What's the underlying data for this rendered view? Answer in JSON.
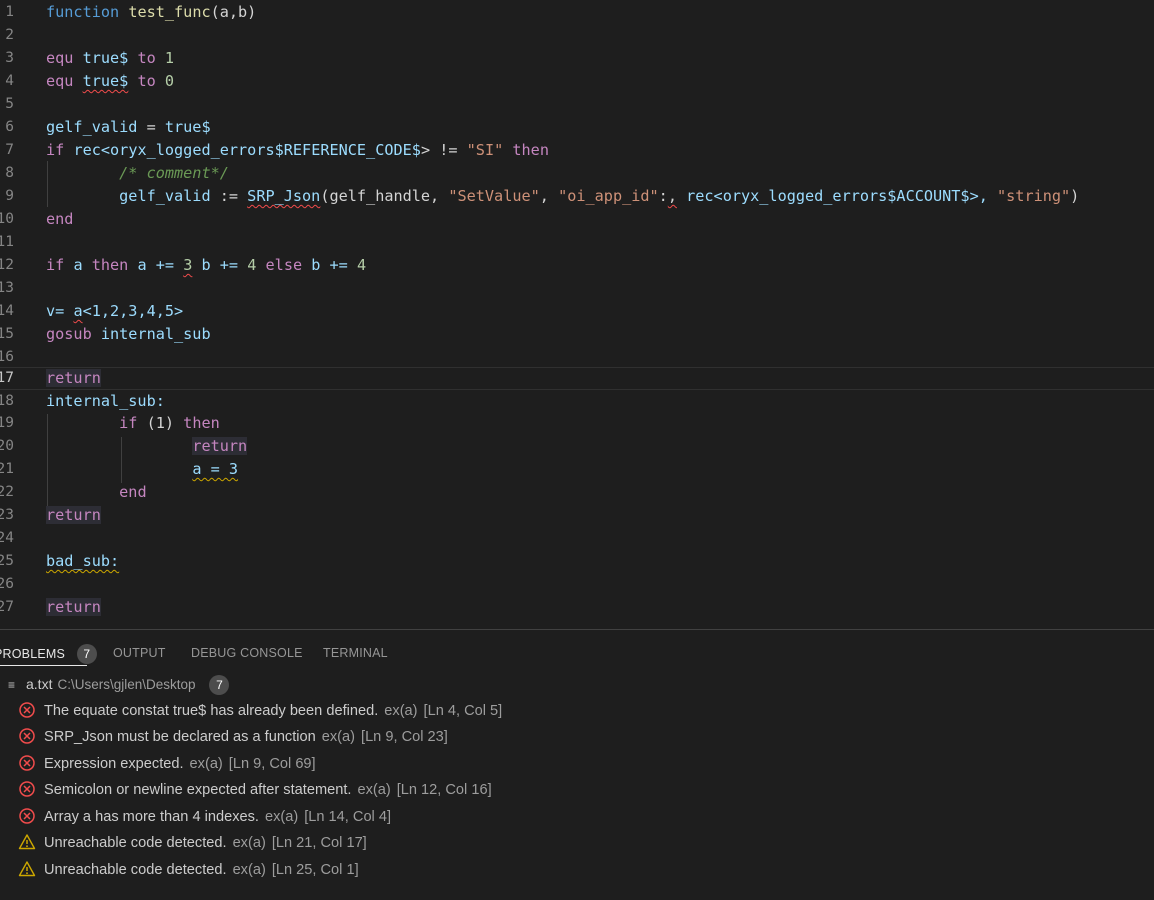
{
  "editor": {
    "line_numbers": [
      "1",
      "2",
      "3",
      "4",
      "5",
      "6",
      "7",
      "8",
      "9",
      "10",
      "11",
      "12",
      "13",
      "14",
      "15",
      "16",
      "17",
      "18",
      "19",
      "20",
      "21",
      "22",
      "23",
      "24",
      "25",
      "26",
      "27"
    ],
    "tokens": {
      "l1_kw": "function",
      "l1_fn": "test_func",
      "l1_rest": "(a,b)",
      "l3_kw": "equ",
      "l3_var": "true$",
      "l3_to": "to",
      "l3_num": "1",
      "l4_kw": "equ",
      "l4_var": "true$",
      "l4_to": "to",
      "l4_num": "0",
      "l6_var": "gelf_valid",
      "l6_op": " = ",
      "l6_val": "true$",
      "l7_kw": "if",
      "l7_a": "rec<",
      "l7_b": "oryx_logged_errors",
      "l7_c": "$REFERENCE_CODE$",
      "l7_d": "> != ",
      "l7_str": "\"SI\"",
      "l7_then": "then",
      "l8_cm": "/* comment*/",
      "l9_var": "gelf_valid",
      "l9_op": " := ",
      "l9_fn": "SRP_Json",
      "l9_a": "(gelf_handle, ",
      "l9_s1": "\"SetValue\"",
      "l9_c1": ", ",
      "l9_s2": "\"oi_app_id\"",
      "l9_c2": ":",
      "l9_c3": ",",
      "l9_b": " rec<oryx_logged_errors$ACCOUNT$>, ",
      "l9_s3": "\"string\"",
      "l9_end": ")",
      "l10_kw": "end",
      "l12_if": "if",
      "l12_a": " a ",
      "l12_then": "then",
      "l12_b": " a += ",
      "l12_n3": "3",
      "l12_c": " b += ",
      "l12_n4": "4",
      "l12_else": "else",
      "l12_d": " b += ",
      "l12_n5": "4",
      "l14_v": "v= ",
      "l14_a": "a",
      "l14_rest": "<1,2,3,4,5>",
      "l15_kw": "gosub",
      "l15_var": "internal_sub",
      "l17_kw": "return",
      "l18_var": "internal_sub:",
      "l19_if": "if",
      "l19_mid": " (1) ",
      "l19_then": "then",
      "l20_kw": "return",
      "l21_a": "a = 3",
      "l22_kw": "end",
      "l23_kw": "return",
      "l25_var": "bad_sub:",
      "l27_kw": "return"
    }
  },
  "panel": {
    "tabs": [
      "PROBLEMS",
      "OUTPUT",
      "DEBUG CONSOLE",
      "TERMINAL"
    ],
    "problems_count": "7",
    "file": {
      "name": "a.txt",
      "path": "C:\\Users\\gjlen\\Desktop",
      "count": "7"
    },
    "problems": [
      {
        "severity": "error",
        "message": "The equate constat true$ has already been defined.",
        "source": "ex(a)",
        "location": "[Ln 4, Col 5]"
      },
      {
        "severity": "error",
        "message": "SRP_Json must be declared as a function",
        "source": "ex(a)",
        "location": "[Ln 9, Col 23]"
      },
      {
        "severity": "error",
        "message": "Expression expected.",
        "source": "ex(a)",
        "location": "[Ln 9, Col 69]"
      },
      {
        "severity": "error",
        "message": "Semicolon or newline expected after statement.",
        "source": "ex(a)",
        "location": "[Ln 12, Col 16]"
      },
      {
        "severity": "error",
        "message": "Array a has more than 4 indexes.",
        "source": "ex(a)",
        "location": "[Ln 14, Col 4]"
      },
      {
        "severity": "warning",
        "message": "Unreachable code detected.",
        "source": "ex(a)",
        "location": "[Ln 21, Col 17]"
      },
      {
        "severity": "warning",
        "message": "Unreachable code detected.",
        "source": "ex(a)",
        "location": "[Ln 25, Col 1]"
      }
    ]
  },
  "colors": {
    "keyword": "#c586c0",
    "variable": "#9cdcfe",
    "function": "#dcdcaa",
    "string": "#ce9178",
    "number": "#b5cea8",
    "comment": "#6a9955",
    "error": "#f14c4c",
    "warning": "#cca700"
  },
  "icons": {
    "error": "error-circle-icon",
    "warning": "warning-triangle-icon",
    "file": "lines-icon"
  }
}
